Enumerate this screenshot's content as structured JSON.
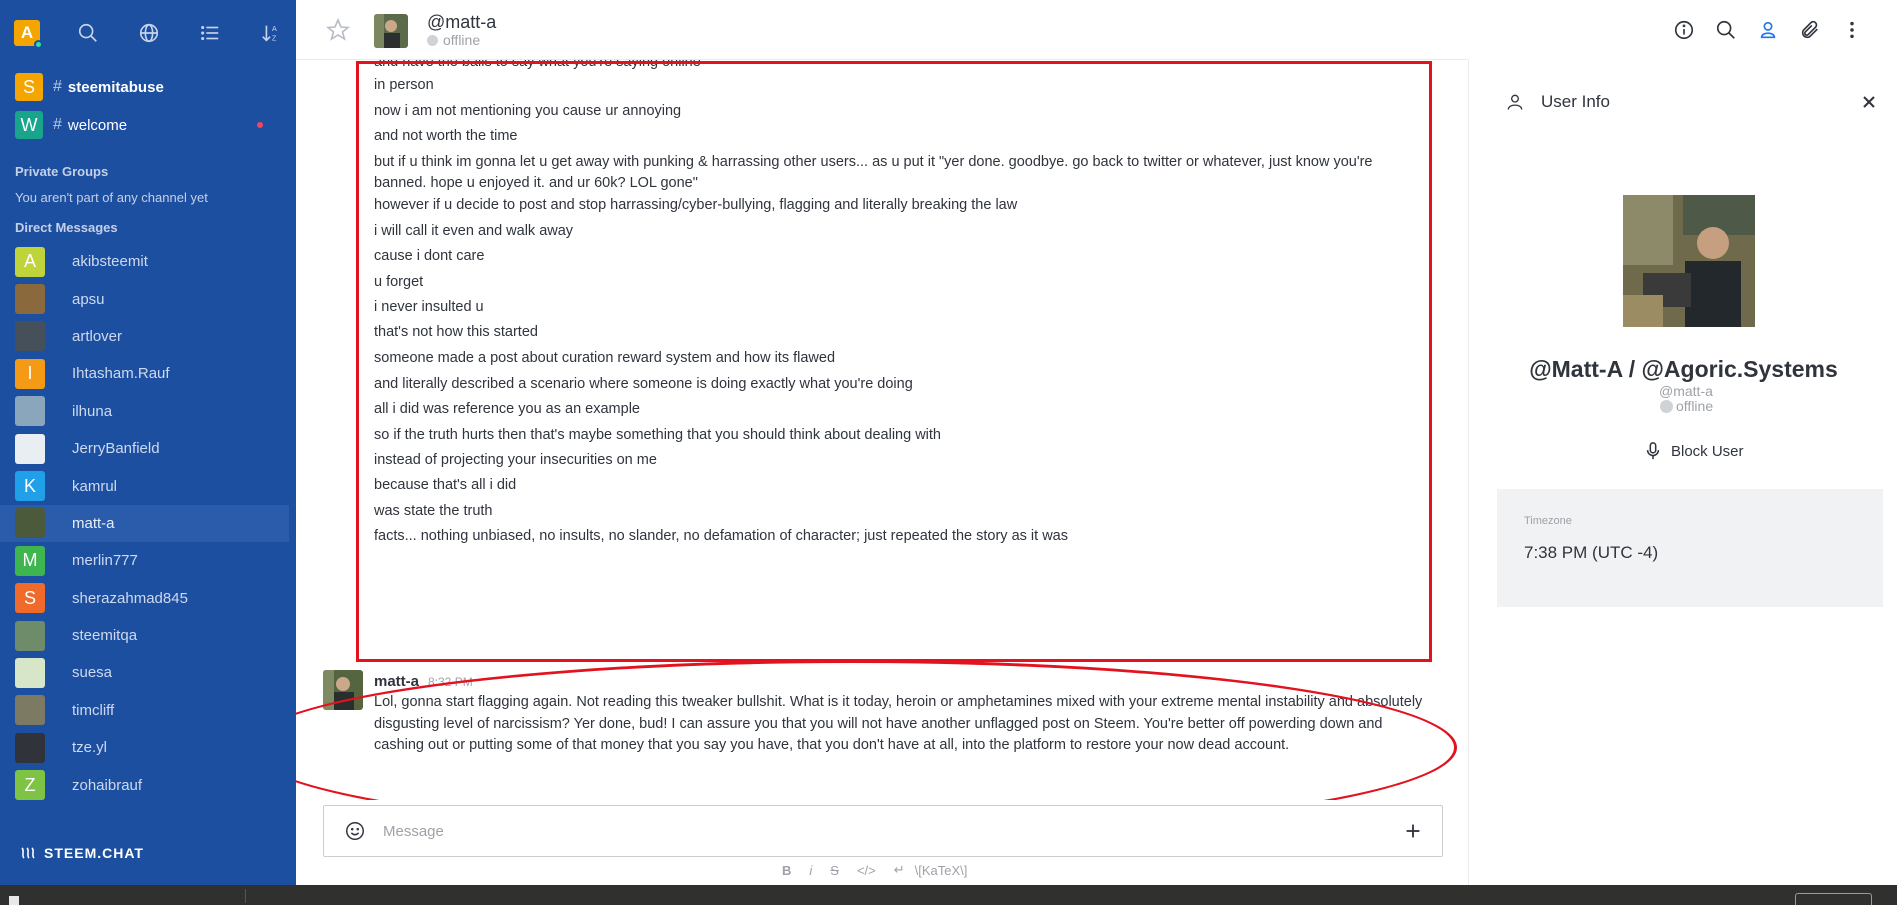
{
  "app": {
    "self_avatar_letter": "A",
    "brand": "STEEM.CHAT"
  },
  "colors": {
    "sidebar": "#1d4fa1",
    "accent": "#1d74f5",
    "annotation": "#e3121f",
    "text": "#2f343d",
    "muted": "#9ea2a8"
  },
  "sidebar": {
    "top_icons": [
      "search-icon",
      "globe-icon",
      "list-icon",
      "sort-icon"
    ],
    "channels": [
      {
        "letter": "S",
        "color": "#f5a500",
        "hash": "#",
        "name": "steemitabuse",
        "bold": true
      },
      {
        "letter": "W",
        "color": "#18a58b",
        "hash": "#",
        "name": "welcome",
        "bold": false
      }
    ],
    "private_groups_title": "Private Groups",
    "private_groups_note": "You aren't part of any channel yet",
    "direct_messages_title": "Direct Messages",
    "direct_messages": [
      {
        "letter": "A",
        "color": "#bfd33a",
        "name": "akibsteemit"
      },
      {
        "letter": "",
        "color": "#8a6a3c",
        "name": "apsu"
      },
      {
        "letter": "",
        "color": "#45505a",
        "name": "artlover"
      },
      {
        "letter": "I",
        "color": "#f59a14",
        "name": "Ihtasham.Rauf"
      },
      {
        "letter": "",
        "color": "#8aa6bd",
        "name": "ilhuna"
      },
      {
        "letter": "",
        "color": "#e9eef3",
        "name": "JerryBanfield"
      },
      {
        "letter": "K",
        "color": "#1fa0e8",
        "name": "kamrul"
      },
      {
        "letter": "",
        "color": "#4a5a3a",
        "name": "matt-a",
        "active": true
      },
      {
        "letter": "M",
        "color": "#3fb550",
        "name": "merlin777"
      },
      {
        "letter": "S",
        "color": "#f06a2c",
        "name": "sherazahmad845"
      },
      {
        "letter": "",
        "color": "#6f8c6a",
        "name": "steemitqa"
      },
      {
        "letter": "",
        "color": "#d7e6c8",
        "name": "suesa"
      },
      {
        "letter": "",
        "color": "#7c7a62",
        "name": "timcliff"
      },
      {
        "letter": "",
        "color": "#30333a",
        "name": "tze.yl"
      },
      {
        "letter": "Z",
        "color": "#7fc345",
        "name": "zohaibrauf"
      }
    ]
  },
  "header": {
    "title": "@matt-a",
    "status": "offline",
    "icons": [
      "info-icon",
      "search-icon",
      "user-icon",
      "paperclip-icon",
      "kebab-icon"
    ]
  },
  "messages": {
    "lines": [
      "and have the balls to say what you're saying online",
      "in person",
      "now i am not mentioning you cause ur annoying",
      "and not worth the time",
      "but if u think im gonna let u get away with punking & harrassing other users... as u put it \"yer done. goodbye. go back to twitter or whatever, just know you're banned. hope u enjoyed it. and ur 60k? LOL gone\"",
      "however if u decide to post and stop harrassing/cyber-bullying, flagging and literally breaking the law",
      "i will call it even and walk away",
      "cause i dont care",
      "u forget",
      "i never insulted u",
      "that's not how this started",
      "someone made a post about curation reward system and how its flawed",
      "and literally described a scenario where someone is doing exactly what you're doing",
      "all i did was reference you as an example",
      "so if the truth hurts then that's maybe something that you should think about dealing with",
      "instead of projecting your insecurities on me",
      "because that's all i did",
      "was state the truth",
      "facts... nothing unbiased, no insults, no slander, no defamation of character; just repeated the story as it was"
    ],
    "reply": {
      "user": "matt-a",
      "time": "8:32 PM",
      "text": "Lol, gonna start flagging again. Not reading this tweaker bullshit. What is it today, heroin or amphetamines mixed with your extreme mental instability and absolutely disgusting level of narcissism? Yer done, bud! I can assure you that you will not have another unflagged post on Steem. You're better off powerding down and cashing out or putting some of that money that you say you have, that you don't have at all, into the platform to restore your now dead account."
    }
  },
  "composer": {
    "placeholder": "Message",
    "format": {
      "bold": "B",
      "italic": "i",
      "strike": "S",
      "code": "</>",
      "newline": "↵",
      "katex": "\\[KaTeX\\]"
    }
  },
  "panel": {
    "title": "User Info",
    "name": "@Matt-A / @Agoric.Systems",
    "username": "@matt-a",
    "status": "offline",
    "block_label": "Block User",
    "timezone_label": "Timezone",
    "timezone_value": "7:38 PM (UTC -4)"
  }
}
